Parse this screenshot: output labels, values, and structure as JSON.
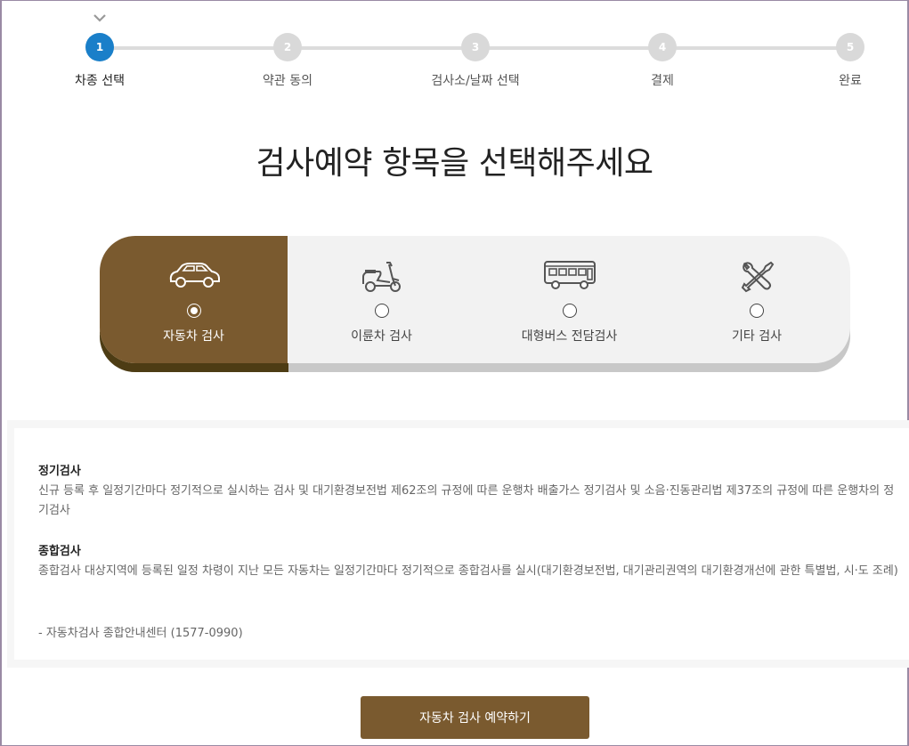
{
  "steps": [
    {
      "number": "1",
      "label": "차종 선택",
      "active": true
    },
    {
      "number": "2",
      "label": "약관 동의"
    },
    {
      "number": "3",
      "label": "검사소/날짜 선택"
    },
    {
      "number": "4",
      "label": "결제"
    },
    {
      "number": "5",
      "label": "완료"
    }
  ],
  "page_title": "검사예약 항목을 선택해주세요",
  "categories": [
    {
      "label": "자동차 검사",
      "icon": "car-icon",
      "selected": true
    },
    {
      "label": "이륜차 검사",
      "icon": "scooter-icon",
      "selected": false
    },
    {
      "label": "대형버스 전담검사",
      "icon": "bus-icon",
      "selected": false
    },
    {
      "label": "기타 검사",
      "icon": "tools-icon",
      "selected": false
    }
  ],
  "info": {
    "regular": {
      "title": "정기검사",
      "body": "신규 등록 후 일정기간마다 정기적으로 실시하는 검사 및 대기환경보전법 제62조의 규정에 따른 운행차 배출가스 정기검사 및 소음·진동관리법 제37조의 규정에 따른 운행차의 정기검사"
    },
    "comprehensive": {
      "title": "종합검사",
      "body": "종합검사 대상지역에 등록된 일정 차령이 지난 모든 자동차는 일정기간마다 정기적으로 종합검사를 실시(대기환경보전법, 대기관리권역의 대기환경개선에 관한 특별법, 시·도 조례)"
    },
    "contact": "- 자동차검사 종합안내센터 (1577-0990)"
  },
  "reserve_button": "자동차 검사 예약하기",
  "colors": {
    "accent_brown": "#7a5a2f",
    "step_active": "#1a7fc9",
    "step_inactive": "#d9d9d9",
    "panel_bg": "#f2f2f2"
  }
}
